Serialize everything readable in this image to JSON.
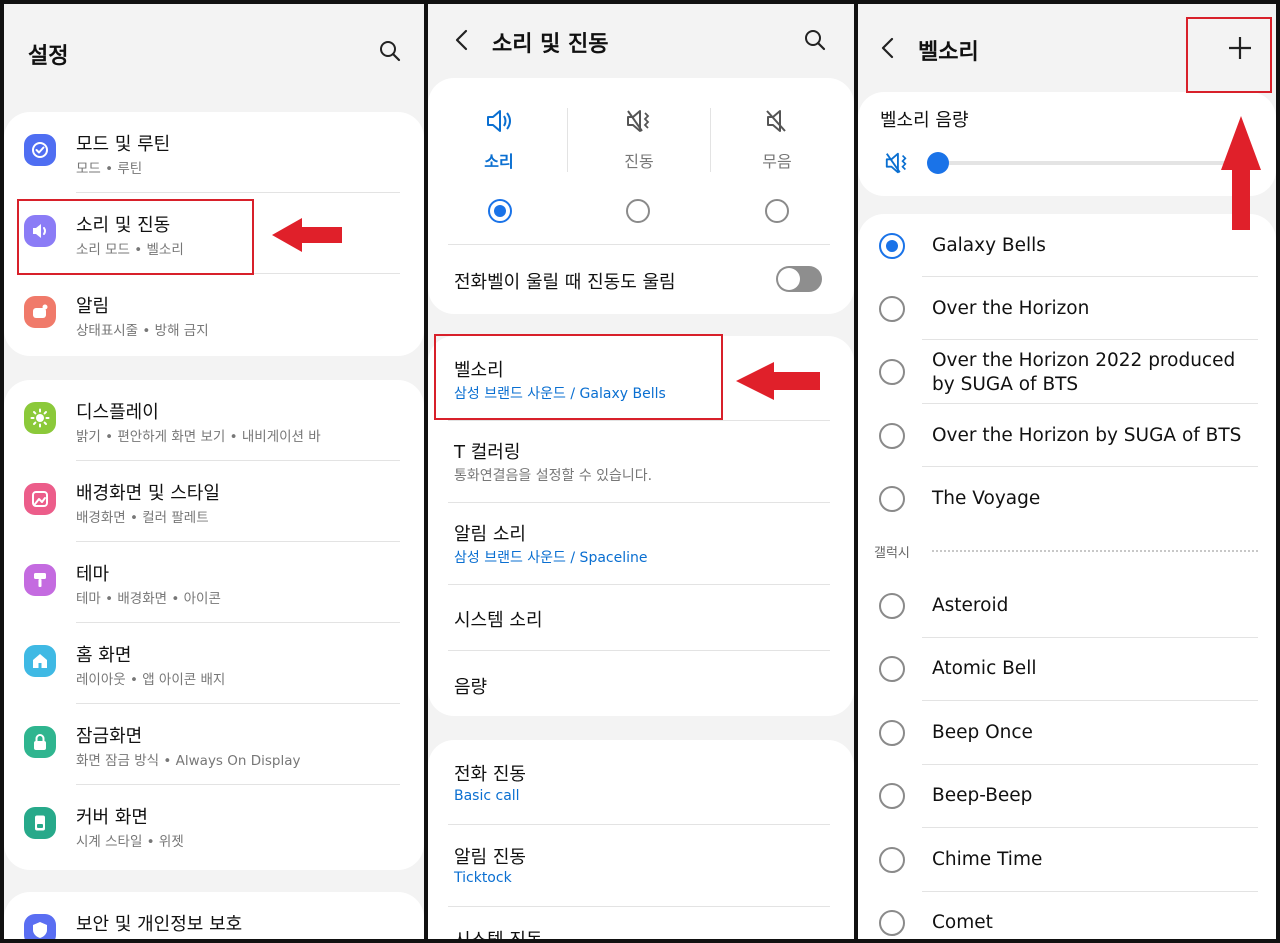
{
  "colors": {
    "accent": "#0a6fd1",
    "highlight": "#d8202a"
  },
  "settings": {
    "title": "설정",
    "groups": [
      [
        {
          "label": "모드 및 루틴",
          "sub": "모드 • 루틴",
          "icon": "mode-routine-icon",
          "color": "#4f6ef2"
        },
        {
          "label": "소리 및 진동",
          "sub": "소리 모드 • 벨소리",
          "icon": "speaker-icon",
          "color": "#8b7cf6"
        },
        {
          "label": "알림",
          "sub": "상태표시줄 • 방해 금지",
          "icon": "notification-icon",
          "color": "#f07a6a"
        }
      ],
      [
        {
          "label": "디스플레이",
          "sub": "밝기 • 편안하게 화면 보기 • 내비게이션 바",
          "icon": "brightness-icon",
          "color": "#8bc93a"
        },
        {
          "label": "배경화면 및 스타일",
          "sub": "배경화면 • 컬러 팔레트",
          "icon": "wallpaper-icon",
          "color": "#ec5d8a"
        },
        {
          "label": "테마",
          "sub": "테마 • 배경화면 • 아이콘",
          "icon": "theme-icon",
          "color": "#c46be0"
        },
        {
          "label": "홈 화면",
          "sub": "레이아웃 • 앱 아이콘 배지",
          "icon": "home-icon",
          "color": "#3fb9e4"
        },
        {
          "label": "잠금화면",
          "sub": "화면 잠금 방식 • Always On Display",
          "icon": "lock-icon",
          "color": "#2fb58f"
        },
        {
          "label": "커버 화면",
          "sub": "시계 스타일 • 위젯",
          "icon": "cover-screen-icon",
          "color": "#27a98a"
        }
      ],
      [
        {
          "label": "보안 및 개인정보 보호",
          "icon": "shield-icon",
          "color": "#5a6ef2"
        }
      ]
    ]
  },
  "sound": {
    "title": "소리 및 진동",
    "modes": [
      {
        "label": "소리",
        "icon": "sound-on-icon",
        "selected": true
      },
      {
        "label": "진동",
        "icon": "vibrate-icon",
        "selected": false
      },
      {
        "label": "무음",
        "icon": "mute-icon",
        "selected": false
      }
    ],
    "vibrate_while_ringing": "전화벨이 울릴 때 진동도 울림",
    "group2": [
      {
        "label": "벨소리",
        "sub": "삼성 브랜드 사운드 / Galaxy Bells"
      },
      {
        "label": "T 컬러링",
        "sub": "통화연결음을 설정할 수 있습니다."
      },
      {
        "label": "알림 소리",
        "sub": "삼성 브랜드 사운드 / Spaceline"
      },
      {
        "label": "시스템 소리"
      },
      {
        "label": "음량"
      }
    ],
    "group3": [
      {
        "label": "전화 진동",
        "sub": "Basic call"
      },
      {
        "label": "알림 진동",
        "sub": "Ticktock"
      },
      {
        "label": "시스템 진동"
      }
    ]
  },
  "ringtone": {
    "title": "벨소리",
    "volume_label": "벨소리 음량",
    "volume_level": 0.0,
    "custom": [
      {
        "label": "Galaxy Bells",
        "selected": true
      },
      {
        "label": "Over the Horizon",
        "selected": false
      },
      {
        "label": "Over the Horizon 2022 produced by SUGA of BTS",
        "selected": false
      },
      {
        "label": "Over the Horizon by SUGA of BTS",
        "selected": false
      },
      {
        "label": "The Voyage",
        "selected": false
      }
    ],
    "section_label": "갤럭시",
    "galaxy": [
      {
        "label": "Asteroid"
      },
      {
        "label": "Atomic Bell"
      },
      {
        "label": "Beep Once"
      },
      {
        "label": "Beep-Beep"
      },
      {
        "label": "Chime Time"
      },
      {
        "label": "Comet"
      }
    ]
  }
}
